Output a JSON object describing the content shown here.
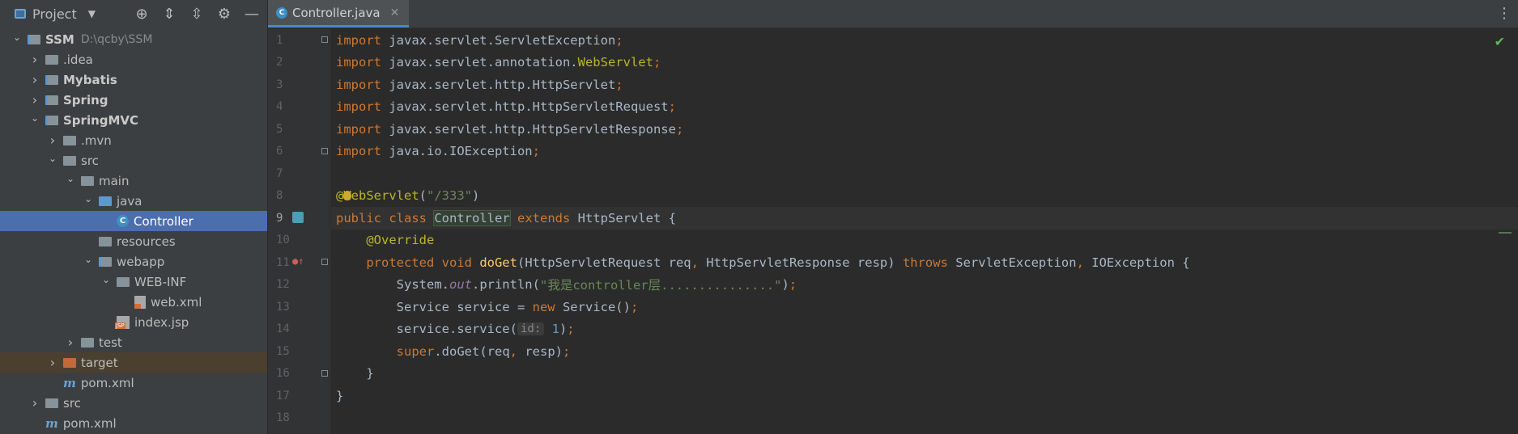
{
  "sidebar": {
    "title": "Project",
    "tree": [
      {
        "label": "SSM",
        "path": "D:\\qcby\\SSM",
        "level": 0,
        "type": "module",
        "expanded": true,
        "bold": true
      },
      {
        "label": ".idea",
        "level": 1,
        "type": "folder",
        "expanded": false
      },
      {
        "label": "Mybatis",
        "level": 1,
        "type": "module-folder",
        "expanded": false,
        "bold": true
      },
      {
        "label": "Spring",
        "level": 1,
        "type": "module-folder",
        "expanded": false,
        "bold": true
      },
      {
        "label": "SpringMVC",
        "level": 1,
        "type": "module-folder",
        "expanded": true,
        "bold": true
      },
      {
        "label": ".mvn",
        "level": 2,
        "type": "folder",
        "expanded": false
      },
      {
        "label": "src",
        "level": 2,
        "type": "folder",
        "expanded": true
      },
      {
        "label": "main",
        "level": 3,
        "type": "folder",
        "expanded": true
      },
      {
        "label": "java",
        "level": 4,
        "type": "folder-blue",
        "expanded": true
      },
      {
        "label": "Controller",
        "level": 5,
        "type": "java-class",
        "selected": true
      },
      {
        "label": "resources",
        "level": 4,
        "type": "folder-res"
      },
      {
        "label": "webapp",
        "level": 4,
        "type": "folder-web",
        "expanded": true
      },
      {
        "label": "WEB-INF",
        "level": 5,
        "type": "folder",
        "expanded": true
      },
      {
        "label": "web.xml",
        "level": 6,
        "type": "xml"
      },
      {
        "label": "index.jsp",
        "level": 5,
        "type": "jsp"
      },
      {
        "label": "test",
        "level": 3,
        "type": "folder",
        "expanded": false
      },
      {
        "label": "target",
        "level": 2,
        "type": "folder-orange",
        "expanded": false,
        "highlighted": true
      },
      {
        "label": "pom.xml",
        "level": 2,
        "type": "maven"
      },
      {
        "label": "src",
        "level": 1,
        "type": "folder",
        "expanded": false
      },
      {
        "label": "pom.xml",
        "level": 1,
        "type": "maven"
      }
    ]
  },
  "editor": {
    "tab_label": "Controller.java",
    "current_line": 9,
    "line_numbers": [
      "1",
      "2",
      "3",
      "4",
      "5",
      "6",
      "7",
      "8",
      "9",
      "10",
      "11",
      "12",
      "13",
      "14",
      "15",
      "16",
      "17",
      "18"
    ],
    "lines": [
      [
        {
          "t": "import ",
          "c": "kw"
        },
        {
          "t": "javax.servlet.ServletException",
          "c": ""
        },
        {
          "t": ";",
          "c": "kw"
        }
      ],
      [
        {
          "t": "import ",
          "c": "kw"
        },
        {
          "t": "javax.servlet.annotation.",
          "c": ""
        },
        {
          "t": "WebServlet",
          "c": "ann"
        },
        {
          "t": ";",
          "c": "kw"
        }
      ],
      [
        {
          "t": "import ",
          "c": "kw"
        },
        {
          "t": "javax.servlet.http.HttpServlet",
          "c": ""
        },
        {
          "t": ";",
          "c": "kw"
        }
      ],
      [
        {
          "t": "import ",
          "c": "kw"
        },
        {
          "t": "javax.servlet.http.HttpServletRequest",
          "c": ""
        },
        {
          "t": ";",
          "c": "kw"
        }
      ],
      [
        {
          "t": "import ",
          "c": "kw"
        },
        {
          "t": "javax.servlet.http.HttpServletResponse",
          "c": ""
        },
        {
          "t": ";",
          "c": "kw"
        }
      ],
      [
        {
          "t": "import ",
          "c": "kw"
        },
        {
          "t": "java.io.IOException",
          "c": ""
        },
        {
          "t": ";",
          "c": "kw"
        }
      ],
      [],
      [
        {
          "t": "@",
          "c": "ann"
        },
        {
          "t": "",
          "c": "bulb"
        },
        {
          "t": "WebServlet",
          "c": "ann"
        },
        {
          "t": "(",
          "c": ""
        },
        {
          "t": "\"/333\"",
          "c": "str"
        },
        {
          "t": ")",
          "c": ""
        }
      ],
      [
        {
          "t": "public class ",
          "c": "kw"
        },
        {
          "t": "Controller",
          "c": "boxcls"
        },
        {
          "t": " extends ",
          "c": "kw"
        },
        {
          "t": "HttpServlet {",
          "c": ""
        }
      ],
      [
        {
          "t": "    ",
          "c": ""
        },
        {
          "t": "@Override",
          "c": "ann"
        }
      ],
      [
        {
          "t": "    ",
          "c": ""
        },
        {
          "t": "protected void ",
          "c": "kw"
        },
        {
          "t": "doGet",
          "c": "fn"
        },
        {
          "t": "(HttpServletRequest req",
          "c": ""
        },
        {
          "t": ", ",
          "c": "kw"
        },
        {
          "t": "HttpServletResponse resp) ",
          "c": ""
        },
        {
          "t": "throws ",
          "c": "kw"
        },
        {
          "t": "ServletException",
          "c": ""
        },
        {
          "t": ", ",
          "c": "kw"
        },
        {
          "t": "IOException {",
          "c": ""
        }
      ],
      [
        {
          "t": "        System.",
          "c": ""
        },
        {
          "t": "out",
          "c": "static"
        },
        {
          "t": ".println(",
          "c": ""
        },
        {
          "t": "\"我是controller层...............\"",
          "c": "str"
        },
        {
          "t": ")",
          "c": ""
        },
        {
          "t": ";",
          "c": "kw"
        }
      ],
      [
        {
          "t": "        Service service = ",
          "c": ""
        },
        {
          "t": "new ",
          "c": "kw"
        },
        {
          "t": "Service()",
          "c": ""
        },
        {
          "t": ";",
          "c": "kw"
        }
      ],
      [
        {
          "t": "        service.service(",
          "c": ""
        },
        {
          "t": "id:",
          "c": "hint"
        },
        {
          "t": " ",
          "c": ""
        },
        {
          "t": "1",
          "c": "num"
        },
        {
          "t": ")",
          "c": ""
        },
        {
          "t": ";",
          "c": "kw"
        }
      ],
      [
        {
          "t": "        ",
          "c": ""
        },
        {
          "t": "super",
          "c": "kw"
        },
        {
          "t": ".doGet(req",
          "c": ""
        },
        {
          "t": ", ",
          "c": "kw"
        },
        {
          "t": "resp)",
          "c": ""
        },
        {
          "t": ";",
          "c": "kw"
        }
      ],
      [
        {
          "t": "    }",
          "c": ""
        }
      ],
      [
        {
          "t": "}",
          "c": ""
        }
      ],
      []
    ]
  },
  "colors": {
    "selection": "#4b6eaf",
    "keyword": "#cc7832",
    "annotation": "#bbb529",
    "string": "#6a8759"
  }
}
